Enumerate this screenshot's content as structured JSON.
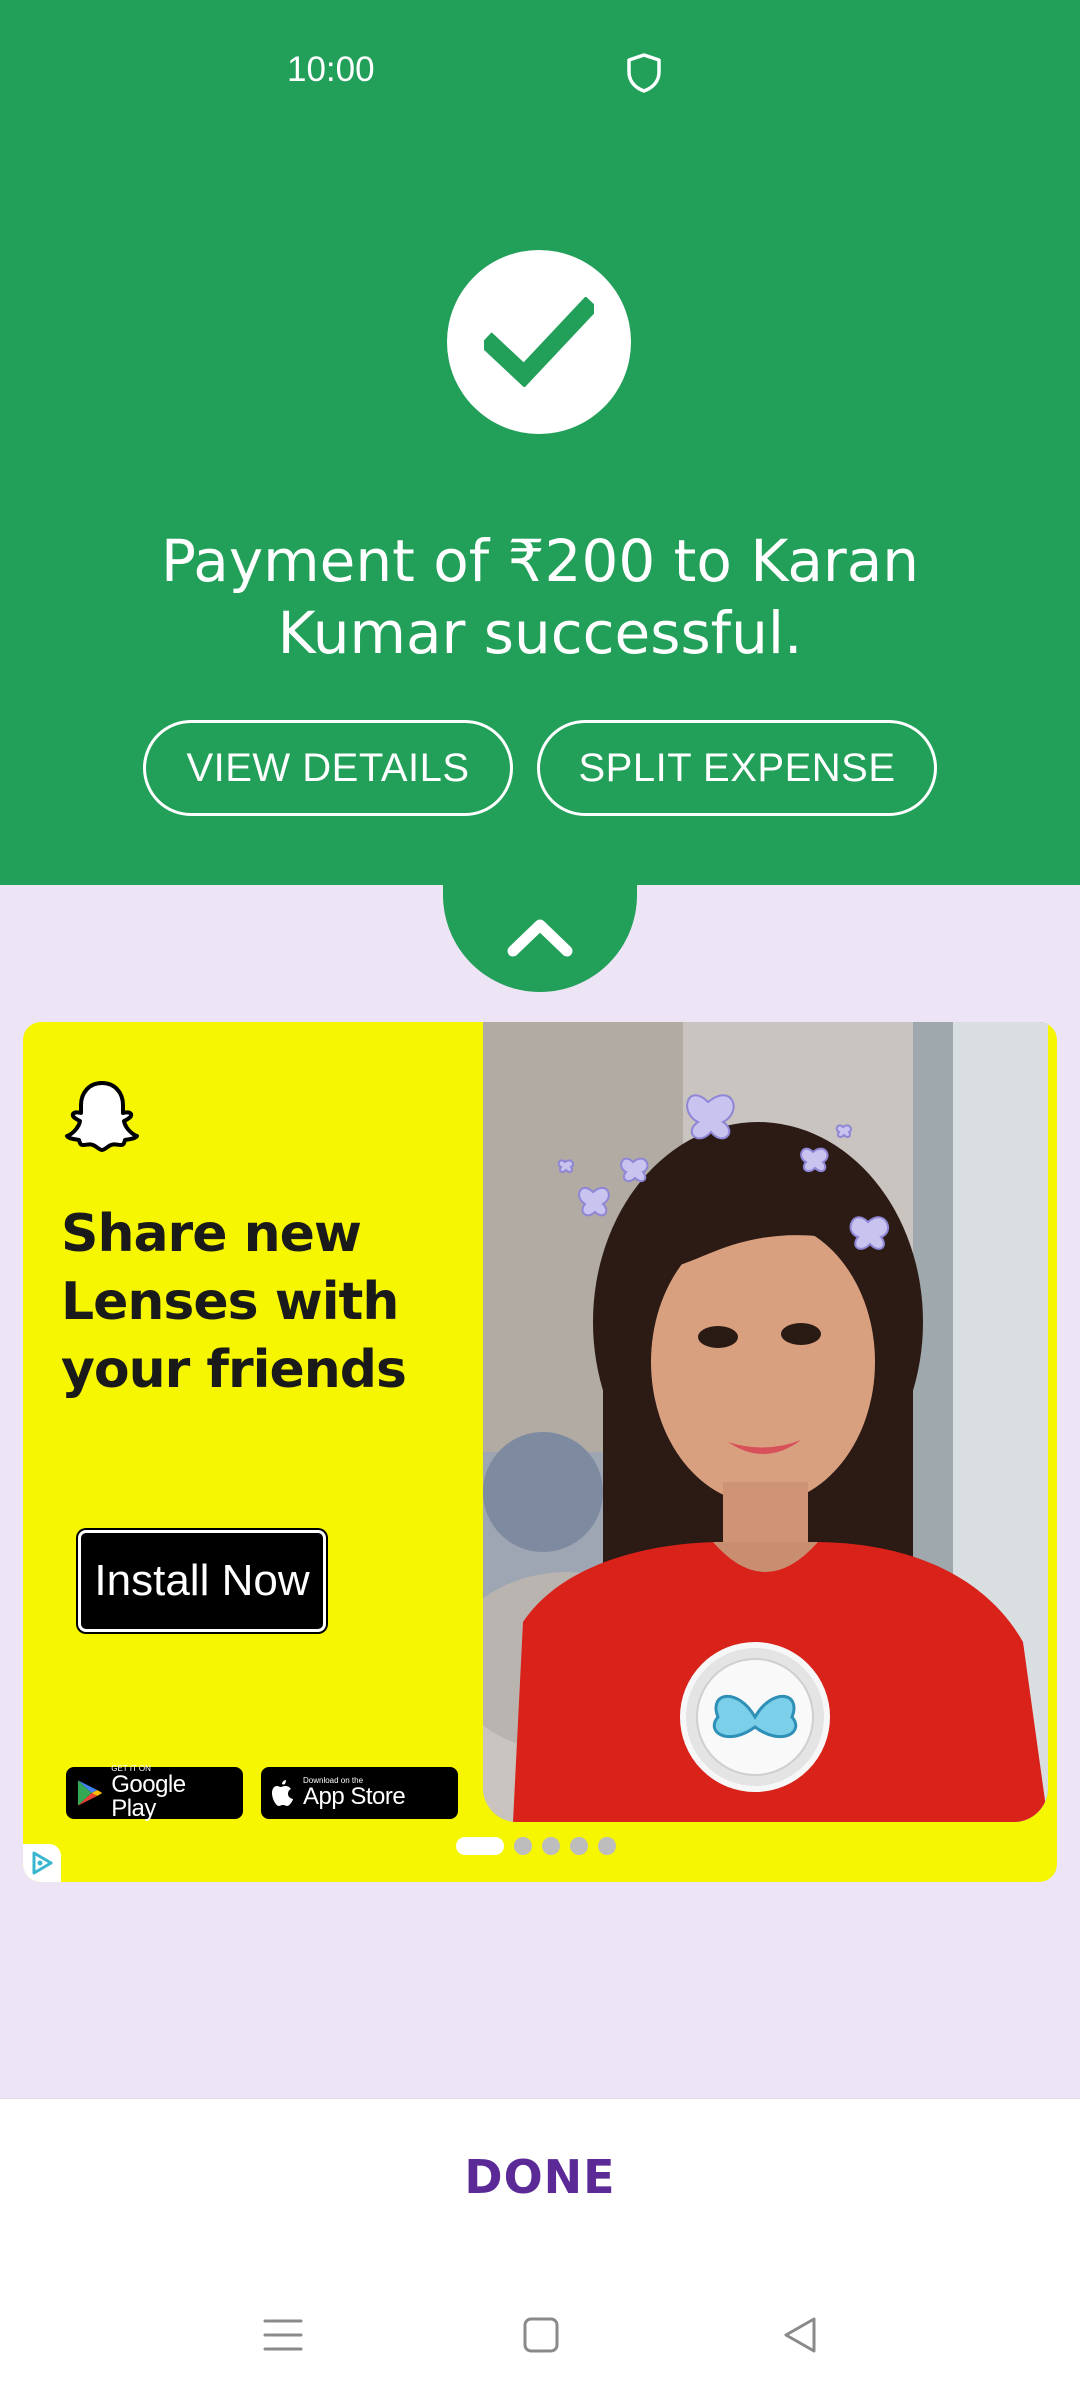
{
  "status_bar": {
    "time": "10:00",
    "shield_icon": "shield-icon"
  },
  "success": {
    "icon": "check-icon",
    "message": "Payment of ₹200 to Karan Kumar successful.",
    "view_details_label": "VIEW DETAILS",
    "split_expense_label": "SPLIT EXPENSE",
    "colors": {
      "primary": "#22a05a",
      "sheet": "#ede4f6"
    }
  },
  "sheet": {
    "handle_icon": "chevron-up-icon"
  },
  "ad": {
    "brand_icon": "snapchat-ghost-icon",
    "headline": "Share new Lenses with your friends",
    "cta_label": "Install Now",
    "google_play": {
      "small": "GET IT ON",
      "big": "Google Play"
    },
    "app_store": {
      "small": "Download on the",
      "big": "App Store"
    },
    "carousel": {
      "total": 5,
      "active_index": 0
    },
    "adchoices_icon": "adchoices-icon",
    "background_color": "#f6f600"
  },
  "footer": {
    "done_label": "DONE",
    "done_color": "#5b2a97"
  },
  "navbar": {
    "menu_icon": "menu-icon",
    "home_icon": "home-square-icon",
    "back_icon": "back-triangle-icon"
  }
}
